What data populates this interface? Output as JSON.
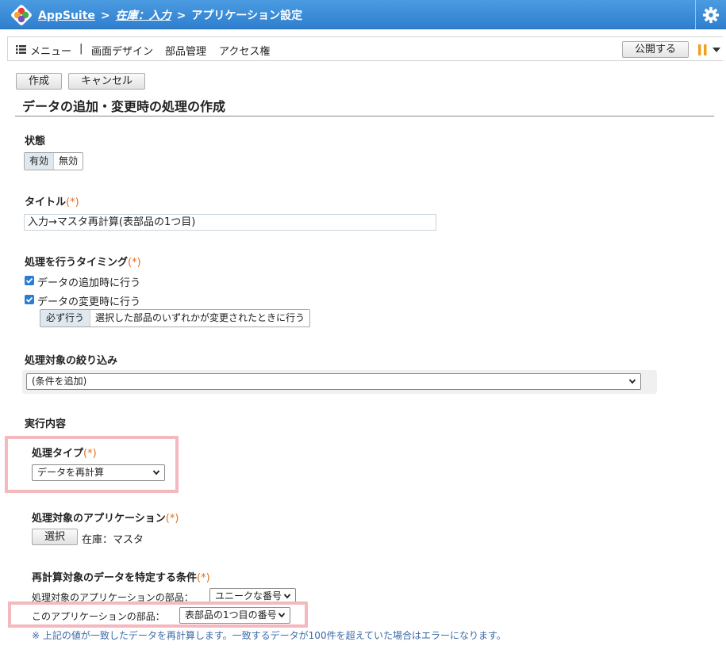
{
  "header": {
    "app_name": "AppSuite",
    "sep1": ">",
    "app_link": "在庫：入力",
    "sep2": ">",
    "current": "アプリケーション設定"
  },
  "menubar": {
    "menu_label": "メニュー",
    "divider": "|",
    "items": [
      "画面デザイン",
      "部品管理",
      "アクセス権"
    ],
    "publish_label": "公開する"
  },
  "actions": {
    "create_label": "作成",
    "cancel_label": "キャンセル"
  },
  "page_title": "データの追加・変更時の処理の作成",
  "state": {
    "label": "状態",
    "options": [
      "有効",
      "無効"
    ],
    "selected": "有効"
  },
  "title_field": {
    "label": "タイトル",
    "required_mark": "(*)",
    "value": "入力→マスタ再計算(表部品の1つ目)"
  },
  "timing": {
    "label": "処理を行うタイミング",
    "required_mark": "(*)",
    "add_label": "データの追加時に行う",
    "change_label": "データの変更時に行う",
    "change_options": [
      "必ず行う",
      "選択した部品のいずれかが変更されたときに行う"
    ]
  },
  "filter": {
    "label": "処理対象の絞り込み",
    "select_value": "(条件を追加)"
  },
  "execution": {
    "label": "実行内容",
    "type_label": "処理タイプ",
    "type_required": "(*)",
    "type_value": "データを再計算",
    "target_app_label": "処理対象のアプリケーション",
    "target_app_required": "(*)",
    "select_button": "選択",
    "target_app_value": "在庫：マスタ",
    "condition_label": "再計算対象のデータを特定する条件",
    "condition_required": "(*)",
    "target_part_label": "処理対象のアプリケーションの部品：",
    "target_part_value": "ユニークな番号",
    "this_part_label": "このアプリケーションの部品：",
    "this_part_value": "表部品の1つ目の番号",
    "note": "※ 上記の値が一致したデータを再計算します。一致するデータが100件を超えていた場合はエラーになります。"
  },
  "colors": {
    "header_bg": "#3a8ddb",
    "required": "#e07020",
    "highlight": "#f4b8bf",
    "checkbox": "#2b7cd3"
  }
}
